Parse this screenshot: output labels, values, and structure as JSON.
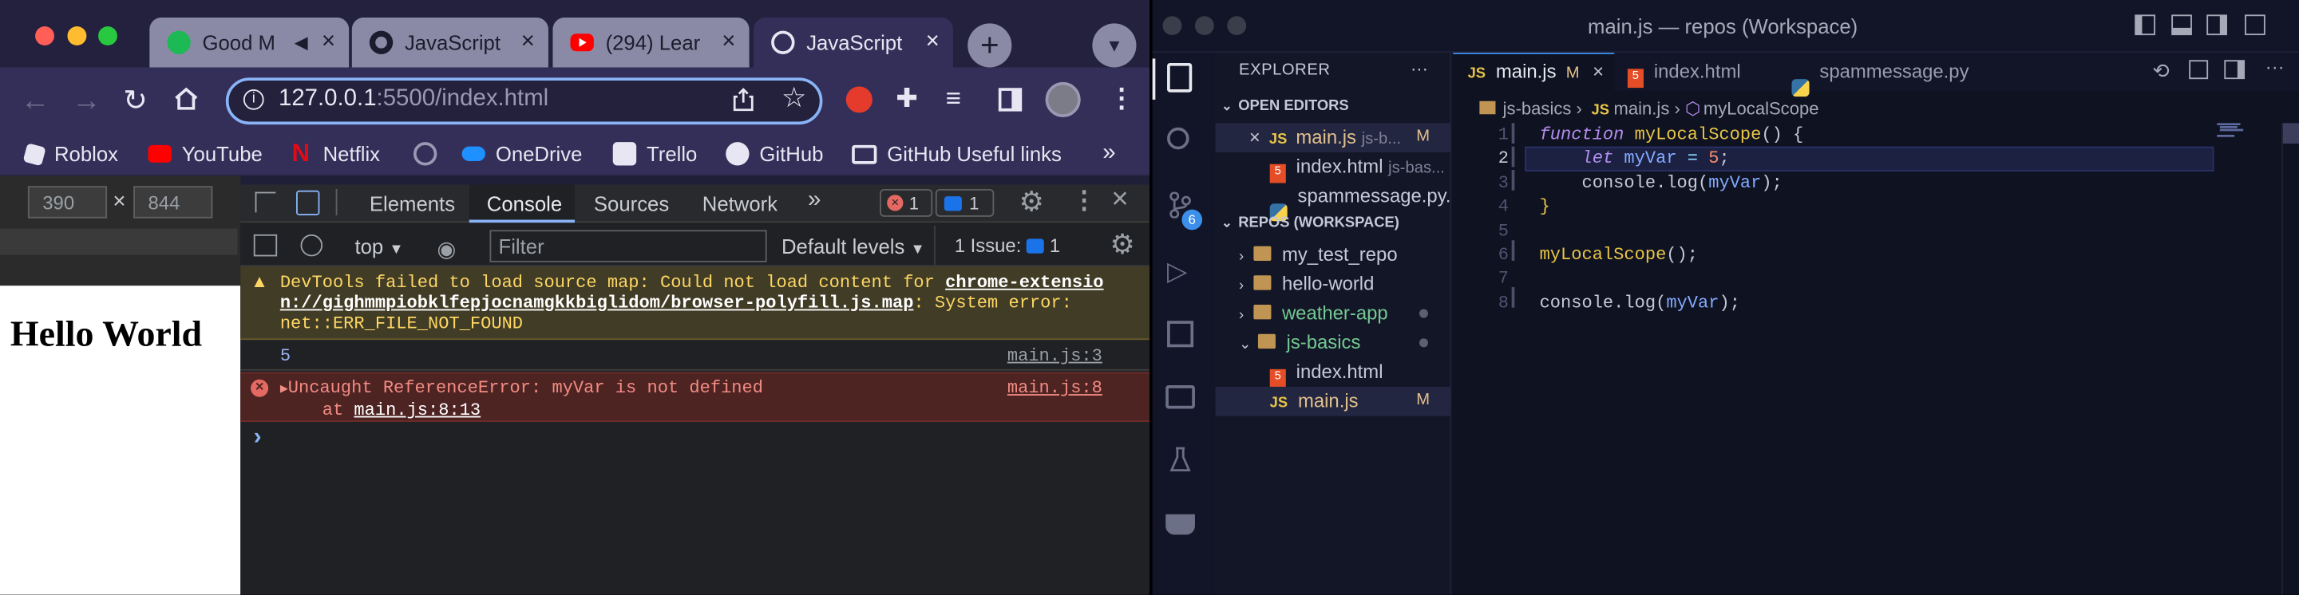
{
  "browser": {
    "tabs": [
      {
        "title": "Good M",
        "icon": "spotify-icon",
        "color": "#1db954"
      },
      {
        "title": "JavaScript",
        "icon": "github-icon",
        "color": "#1c1c2e"
      },
      {
        "title": "(294) Lear",
        "icon": "youtube-icon",
        "color": "#ff0000"
      },
      {
        "title": "JavaScript",
        "icon": "globe-icon",
        "color": "#ffffff"
      }
    ],
    "url_host": "127.0.0.1",
    "url_rest": ":5500/index.html",
    "bookmarks": [
      "Roblox",
      "YouTube",
      "Netflix",
      "OneDrive",
      "Trello",
      "GitHub",
      "GitHub Useful links"
    ],
    "more_bookmarks": "»"
  },
  "device": {
    "width": "390",
    "height": "844",
    "times": "×"
  },
  "page": {
    "heading": "Hello World"
  },
  "devtools": {
    "tabs": [
      "Elements",
      "Console",
      "Sources",
      "Network"
    ],
    "more": "»",
    "errors_count": "1",
    "messages_count": "1",
    "context": "top",
    "filter_placeholder": "Filter",
    "levels": "Default levels",
    "issues_label": "1 Issue:",
    "issues_count": "1",
    "warning_line1_prefix": "DevTools failed to load source map: Could not load content for ",
    "warning_link1": "chrome-extensio",
    "warning_link2": "n://gighmmpiobklfepjocnamgkkbiglidom/browser-polyfill.js.map",
    "warning_line2_suffix": ": System error:",
    "warning_line3": "net::ERR_FILE_NOT_FOUND",
    "log_value": "5",
    "log_source": "main.js:3",
    "error_text": "Uncaught ReferenceError: myVar is not defined",
    "error_source": "main.js:8",
    "error_at": "at ",
    "error_at_link": "main.js:8:13",
    "prompt": "›"
  },
  "vscode": {
    "window_title": "main.js — repos (Workspace)",
    "tabs": [
      {
        "label": "main.js",
        "badge": "M",
        "icon": "JS",
        "icon_color": "#e8c547"
      },
      {
        "label": "index.html",
        "icon": "5",
        "icon_color": "#e44d26"
      },
      {
        "label": "spammessage.py",
        "icon": "py",
        "icon_color": "#3572a5"
      }
    ],
    "explorer_title": "EXPLORER",
    "explorer_more": "···",
    "open_editors_label": "OPEN EDITORS",
    "open_editors": [
      {
        "name": "main.js",
        "detail": "js-b...",
        "badge": "M",
        "icon": "JS",
        "close": "×"
      },
      {
        "name": "index.html",
        "detail": "js-bas...",
        "icon": "5"
      },
      {
        "name": "spammessage.py...",
        "detail": "",
        "icon": "py"
      }
    ],
    "workspace_label": "REPOS (WORKSPACE)",
    "folders": [
      {
        "name": "my_test_repo",
        "color": "#c5c8d6"
      },
      {
        "name": "hello-world",
        "color": "#c5c8d6"
      },
      {
        "name": "weather-app",
        "color": "#73c991"
      },
      {
        "name": "js-basics",
        "color": "#73c991"
      }
    ],
    "files": [
      {
        "name": "index.html",
        "icon": "5"
      },
      {
        "name": "main.js",
        "icon": "JS",
        "badge": "M"
      }
    ],
    "scm_badge": "6",
    "breadcrumb": [
      "js-basics",
      "main.js",
      "myLocalScope"
    ],
    "breadcrumb_sep": "›",
    "line_numbers": [
      "1",
      "2",
      "3",
      "4",
      "5",
      "6",
      "7",
      "8"
    ],
    "code": [
      [
        {
          "t": "function ",
          "c": "kw-i"
        },
        {
          "t": "myLocalScope",
          "c": "fn"
        },
        {
          "t": "() {",
          "c": "punc"
        }
      ],
      [
        {
          "t": "    "
        },
        {
          "t": "let ",
          "c": "kw-i"
        },
        {
          "t": "myVar",
          "c": "var"
        },
        {
          "t": " = ",
          "c": "op"
        },
        {
          "t": "5",
          "c": "num"
        },
        {
          "t": ";",
          "c": "punc"
        }
      ],
      [
        {
          "t": "    "
        },
        {
          "t": "console",
          "c": "plain"
        },
        {
          "t": ".",
          "c": "punc"
        },
        {
          "t": "log",
          "c": "plain"
        },
        {
          "t": "(",
          "c": "punc"
        },
        {
          "t": "myVar",
          "c": "var"
        },
        {
          "t": ");",
          "c": "punc"
        }
      ],
      [
        {
          "t": "}",
          "c": "brace"
        }
      ],
      [],
      [
        {
          "t": "myLocalScope",
          "c": "fn"
        },
        {
          "t": "();",
          "c": "punc"
        }
      ],
      [],
      [
        {
          "t": "console",
          "c": "plain"
        },
        {
          "t": ".",
          "c": "punc"
        },
        {
          "t": "log",
          "c": "plain"
        },
        {
          "t": "(",
          "c": "punc"
        },
        {
          "t": "myVar",
          "c": "var"
        },
        {
          "t": ");",
          "c": "punc"
        }
      ]
    ]
  },
  "colors": {
    "accent": "#8ab4f8",
    "error": "#f28b82",
    "warning": "#fdd663",
    "js": "#e8c547",
    "html": "#e44d26",
    "modified": "#e2c08d"
  }
}
